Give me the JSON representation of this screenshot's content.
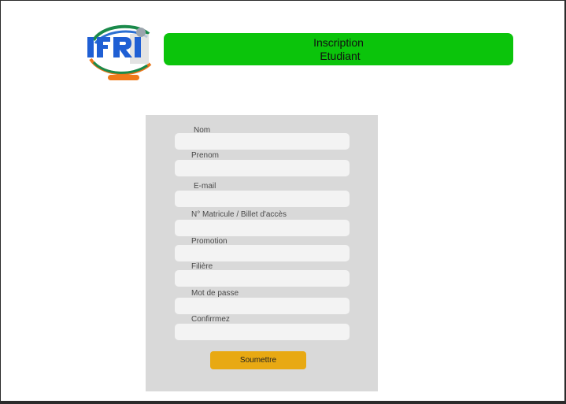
{
  "header": {
    "logo_text": "IFRI",
    "title_line1": "Inscription",
    "title_line2": "Etudiant",
    "title_color": "#0bc40b"
  },
  "form": {
    "fields": [
      {
        "label": "Nom",
        "value": ""
      },
      {
        "label": "Prenom",
        "value": ""
      },
      {
        "label": "E-mail",
        "value": ""
      },
      {
        "label": "N° Matricule / Billet d'accès",
        "value": ""
      },
      {
        "label": "Promotion",
        "value": ""
      },
      {
        "label": "Filière",
        "value": ""
      },
      {
        "label": "Mot de passe",
        "value": ""
      },
      {
        "label": "Confirrmez",
        "value": ""
      }
    ],
    "submit_label": "Soumettre",
    "submit_color": "#e8a913"
  }
}
